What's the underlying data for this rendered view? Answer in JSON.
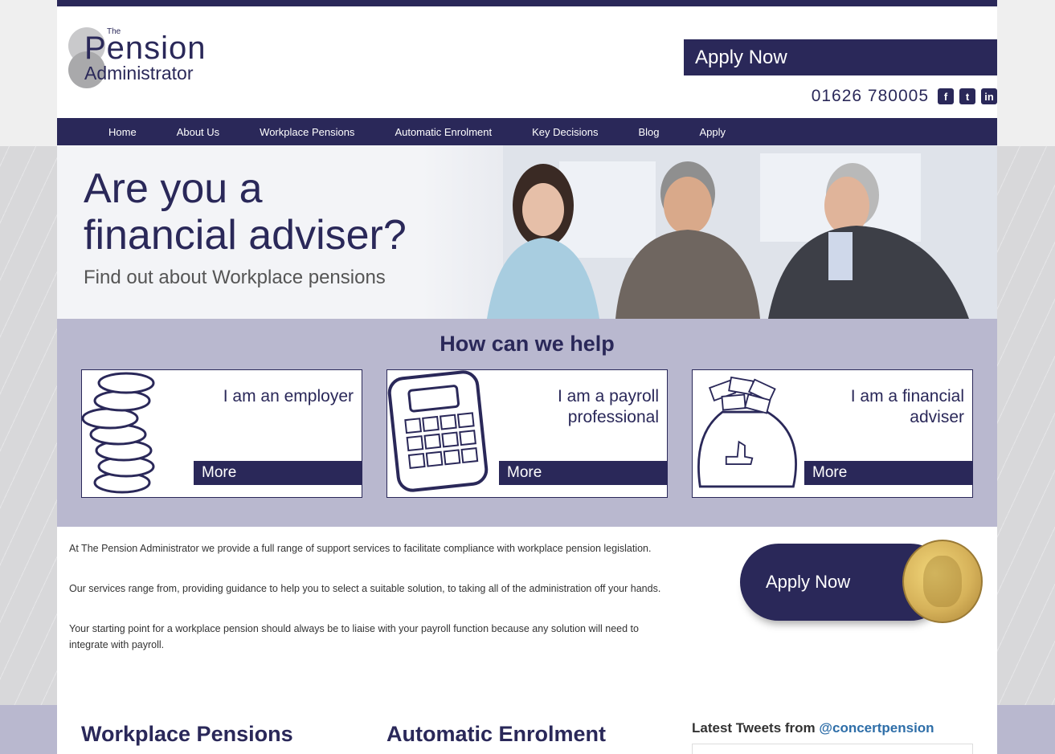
{
  "header": {
    "logo": {
      "the": "The",
      "pension": "Pension",
      "administrator": "Administrator"
    },
    "apply_button": "Apply Now",
    "phone": "01626 780005",
    "social": [
      {
        "name": "facebook-icon",
        "glyph": "f"
      },
      {
        "name": "twitter-icon",
        "glyph": "t"
      },
      {
        "name": "linkedin-icon",
        "glyph": "in"
      }
    ]
  },
  "nav": {
    "items": [
      "Home",
      "About Us",
      "Workplace Pensions",
      "Automatic Enrolment",
      "Key Decisions",
      "Blog",
      "Apply"
    ]
  },
  "hero": {
    "line1": "Are you a",
    "line2": "financial adviser?",
    "line3": "Find out about Workplace pensions"
  },
  "help": {
    "title": "How can we help",
    "cards": [
      {
        "text": "I am an employer",
        "more": "More",
        "art": "coins-icon"
      },
      {
        "text": "I am a payroll professional",
        "more": "More",
        "art": "calculator-icon"
      },
      {
        "text": "I am a financial adviser",
        "more": "More",
        "art": "money-bag-icon"
      }
    ]
  },
  "intro": {
    "paragraphs": [
      "At The Pension Administrator we provide a full range of support services to facilitate compliance with workplace pension legislation.",
      "Our services range from, providing guidance to help you to select a suitable solution, to taking all of the administration off your hands.",
      "Your starting point for a workplace pension should always be to liaise with your payroll function because any solution will need to integrate with payroll."
    ]
  },
  "apply_pill": "Apply Now",
  "sections": {
    "workplace": "Workplace Pensions",
    "enrolment": "Automatic Enrolment",
    "tweets_prefix": "Latest Tweets from",
    "tweets_handle": "@concertpension"
  },
  "colors": {
    "brand": "#2a2859",
    "lavender": "#b9b8cf",
    "link": "#2e6ea8"
  }
}
